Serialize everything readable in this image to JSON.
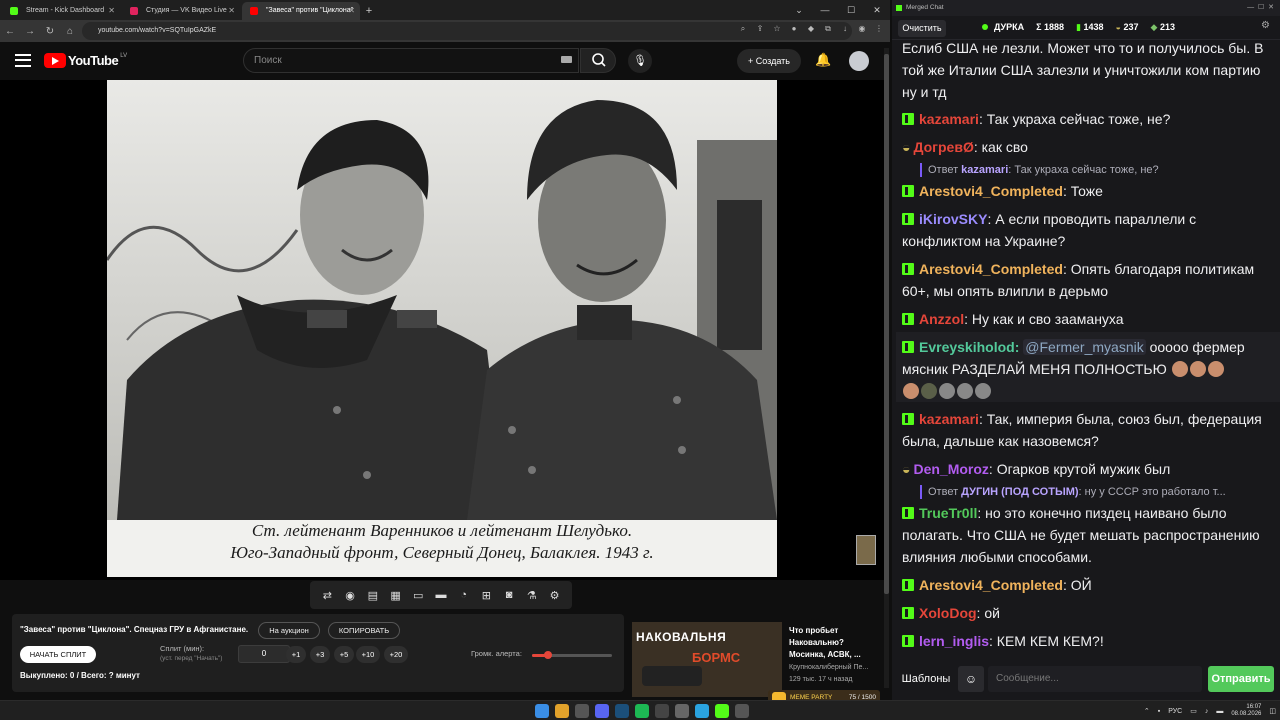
{
  "browser": {
    "tabs": [
      {
        "title": "Stream - Kick Dashboard",
        "color": "#53fc18"
      },
      {
        "title": "Студия — VK Видео Live",
        "color": "#e0245e"
      },
      {
        "title": "\"Завеса\" против \"Циклона\"",
        "color": "#ff0000",
        "active": true
      }
    ],
    "new_tab": "+",
    "url": "youtube.com/watch?v=SQTuIpGAZkE"
  },
  "youtube": {
    "logo_text": "YouTube",
    "country": "LV",
    "search_placeholder": "Поиск",
    "create_label": "Создать"
  },
  "video": {
    "caption_line1": "Ст. лейтенант Варенников и лейтенант Шелудько.",
    "caption_line2": "Юго-Западный фронт, Северный Донец, Балаклея. 1943 г."
  },
  "panel": {
    "title": "\"Завеса\" против \"Циклона\". Спецназ ГРУ в Афганистане.",
    "auction_label": "На аукцион",
    "copy_label": "КОПИРОВАТЬ",
    "start_split_label": "НАЧАТЬ СПЛИТ",
    "split_label": "Сплит (мин):",
    "split_hint": "(уст. перед \"Начать\")",
    "split_value": "0",
    "increments": [
      "+1",
      "+3",
      "+5",
      "+10",
      "+20"
    ],
    "alert_label": "Громк. алерта:",
    "alert_level": 0.2,
    "bought_text": "Выкуплено: 0 / Всего: ? минут"
  },
  "recommendation": {
    "thumb_text1": "НАКОВАЛЬНЯ",
    "thumb_text2": "БОРМС",
    "title": "Что пробьет Наковальню? Мосинка, АСВК, ...",
    "channel": "Крупнокалиберный Пе...",
    "meta": "129 тыс.  17 ч назад"
  },
  "meme_party": {
    "label": "MEME PARTY",
    "count": "75 / 1500"
  },
  "chat": {
    "window_title": "Merged Chat",
    "clear_label": "Очистить",
    "channel": "ДУРКА",
    "stat_sum": "Σ 1888",
    "stat_kick": "1438",
    "stat_a": "237",
    "stat_b": "213",
    "messages": [
      {
        "user": "",
        "text": "Еслиб США не лезли. Может что то и получилось бы. В той же Италии США залезли  и уничтожили ком партию ну и тд",
        "color": "#efeff1"
      },
      {
        "user": "kazamari",
        "text": ": Так украха сейчас тоже, не?",
        "color": "#e5463a"
      },
      {
        "user": "ДогревØ",
        "text": ": как сво",
        "color": "#e5463a"
      },
      {
        "user": "Arestovi4_Completed",
        "text": ": Тоже",
        "color": "#f0b35c"
      },
      {
        "user": "iKirovSKY",
        "text": ": А если проводить параллели с конфликтом на Украине?",
        "color": "#9b8cff"
      },
      {
        "user": "Arestovi4_Completed",
        "text": ": Опять благодаря политикам 60+, мы опять влипли в дерьмо",
        "color": "#f0b35c"
      },
      {
        "user": "Anzzol",
        "text": ": Ну как и сво заамануха",
        "color": "#e5463a"
      },
      {
        "user": "Evreyskiholod",
        "text": "ооооо фермер мясник РАЗДЕЛАЙ МЕНЯ ПОЛНОСТЬЮ",
        "color": "#53c99b"
      },
      {
        "user": "kazamari",
        "text": ": Так, империя была, союз был, федерация была, дальше как назовемся?",
        "color": "#e5463a"
      },
      {
        "user": "Den_Moroz",
        "text": ": Огарков крутой мужик был",
        "color": "#b25cf0"
      },
      {
        "user": "TrueTr0ll",
        "text": ": но это конечно пиздец наивано было полагать. Что США не будет мешать распространению влияния любыми способами.",
        "color": "#53c95b"
      },
      {
        "user": "Arestovi4_Completed",
        "text": ": ОЙ",
        "color": "#f0b35c"
      },
      {
        "user": "XoloDog",
        "text": ": ой",
        "color": "#e5463a"
      },
      {
        "user": "lern_inglis",
        "text": ": КЕМ КЕМ КЕМ?!",
        "color": "#b25cf0"
      }
    ],
    "mention": "@Fermer_myasnik",
    "reply1_prefix": "Ответ",
    "reply1_user": "kazamari",
    "reply1_text": ": Так украха сейчас тоже, не?",
    "reply2_user": "ДУГИН (ПОД СОТЫМ)",
    "reply2_text": ": ну у СССР это работало т...",
    "templates_label": "Шаблоны",
    "input_placeholder": "Сообщение...",
    "send_label": "Отправить"
  },
  "taskbar": {
    "lang": "РУС",
    "time": "16:07",
    "date": "08.08.2026"
  }
}
